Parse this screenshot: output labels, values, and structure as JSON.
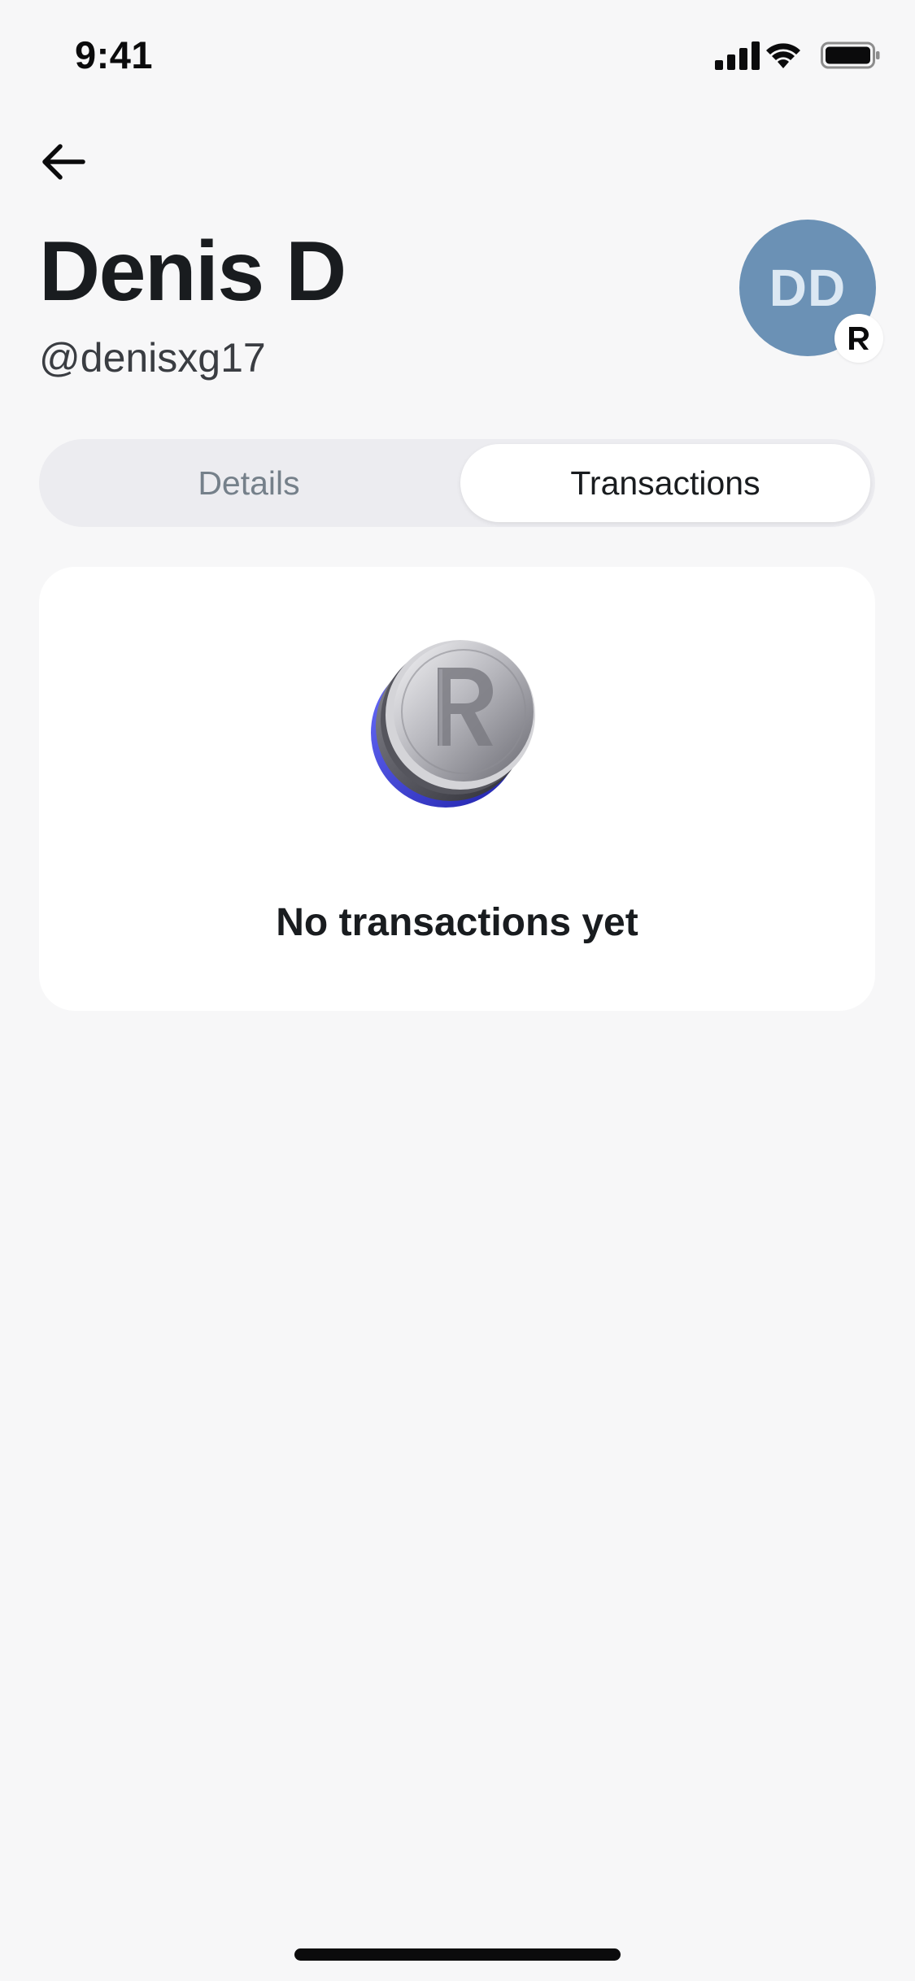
{
  "status_bar": {
    "time": "9:41",
    "icons": [
      "cellular-signal-icon",
      "wifi-icon",
      "battery-icon"
    ]
  },
  "header": {
    "back_icon": "arrow-left-icon",
    "name": "Denis D",
    "handle": "@denisxg17"
  },
  "avatar": {
    "initials": "DD",
    "badge_icon": "revolut-r-icon",
    "colors": {
      "avatar_bg": "#6b91b5",
      "avatar_text": "#dce8f3"
    }
  },
  "tabs": {
    "items": [
      {
        "label": "Details",
        "selected": false
      },
      {
        "label": "Transactions",
        "selected": true
      }
    ]
  },
  "transactions_card": {
    "illustration": "revolut-coin-icon",
    "empty_text": "No transactions yet"
  },
  "colors": {
    "background": "#f7f7f8",
    "card": "#ffffff",
    "text_primary": "#191c1f",
    "text_muted": "#75808a",
    "coin_accent": "#3b3fd8"
  }
}
